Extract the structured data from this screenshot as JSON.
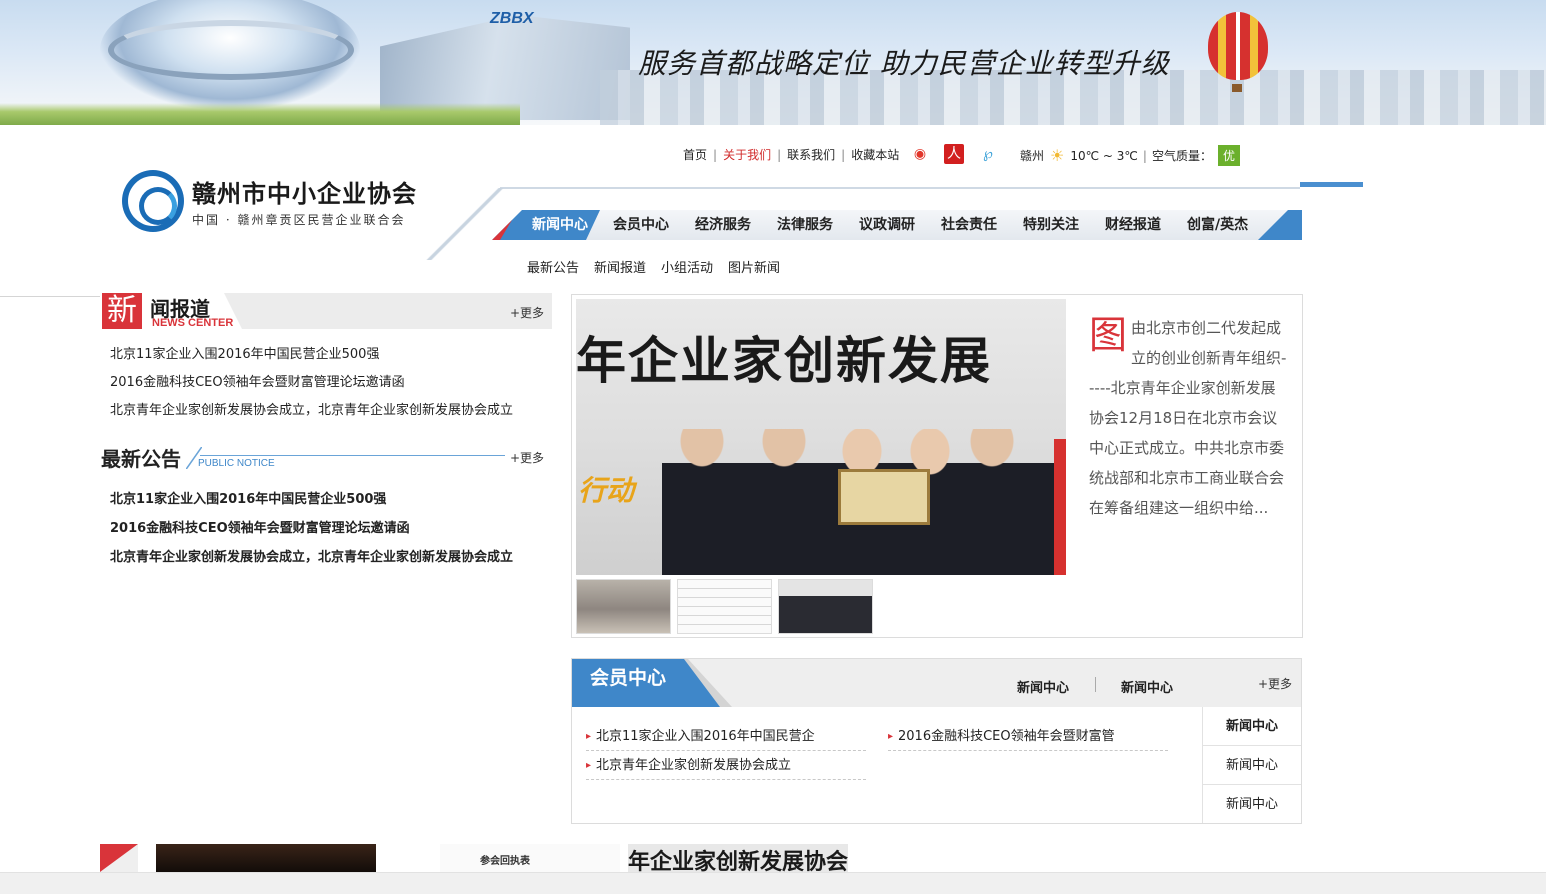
{
  "banner": {
    "slogan": "服务首都战略定位   助力民营企业转型升级",
    "building_logo": "ZBBX"
  },
  "topnav": {
    "items": [
      {
        "label": "首页",
        "active": false
      },
      {
        "label": "关于我们",
        "active": true
      },
      {
        "label": "联系我们",
        "active": false
      },
      {
        "label": "收藏本站",
        "active": false
      }
    ]
  },
  "social": {
    "weibo": "weibo-icon",
    "renren": "人",
    "tencent": "tencent-weibo-icon"
  },
  "weather": {
    "city": "赣州",
    "temp": "10℃ ~ 3℃",
    "air_label": "空气质量：",
    "air_value": "优"
  },
  "logo": {
    "name": "赣州市中小企业协会",
    "sub": "中国 · 赣州章贡区民营企业联合会"
  },
  "mainnav": {
    "items": [
      "新闻中心",
      "会员中心",
      "经济服务",
      "法律服务",
      "议政调研",
      "社会责任",
      "特别关注",
      "财经报道",
      "创富/英杰"
    ]
  },
  "subnav": {
    "items": [
      "最新公告",
      "新闻报道",
      "小组活动",
      "图片新闻"
    ]
  },
  "news_center": {
    "big_char": "新",
    "rest_title": "闻报道",
    "en": "NEWS CENTER",
    "more": "+更多",
    "items": [
      "北京11家企业入围2016年中国民营企业500强",
      "2016金融科技CEO领袖年会暨财富管理论坛邀请函",
      "北京青年企业家创新发展协会成立，北京青年企业家创新发展协会成立"
    ]
  },
  "notice": {
    "title": "最新公告",
    "en": "PUBLIC NOTICE",
    "more": "+更多",
    "items": [
      "北京11家企业入围2016年中国民营企业500强",
      "2016金融科技CEO领袖年会暨财富管理论坛邀请函",
      "北京青年企业家创新发展协会成立，北京青年企业家创新发展协会成立"
    ]
  },
  "photo_news": {
    "banner_text": "年企业家创新发展",
    "action_text": "行动",
    "desc_first": "图",
    "desc": "由北京市创二代发起成立的创业创新青年组织-----北京青年企业家创新发展协会12月18日在北京市会议中心正式成立。中共北京市委统战部和北京市工商业联合会在筹备组建这一组织中给..."
  },
  "member_center": {
    "title": "会员中心",
    "links": [
      "新闻中心",
      "新闻中心"
    ],
    "more": "+更多",
    "items": [
      "北京11家企业入围2016年中国民营企",
      "2016金融科技CEO领袖年会暨财富管",
      "北京青年企业家创新发展协会成立"
    ],
    "side": [
      "新闻中心",
      "新闻中心",
      "新闻中心"
    ]
  },
  "bottom": {
    "form_text": "参会回执表",
    "banner_text": "年企业家创新发展协会"
  },
  "colors": {
    "accent_blue": "#3f87c9",
    "accent_red": "#d9343a",
    "air_good": "#6bb02c"
  }
}
